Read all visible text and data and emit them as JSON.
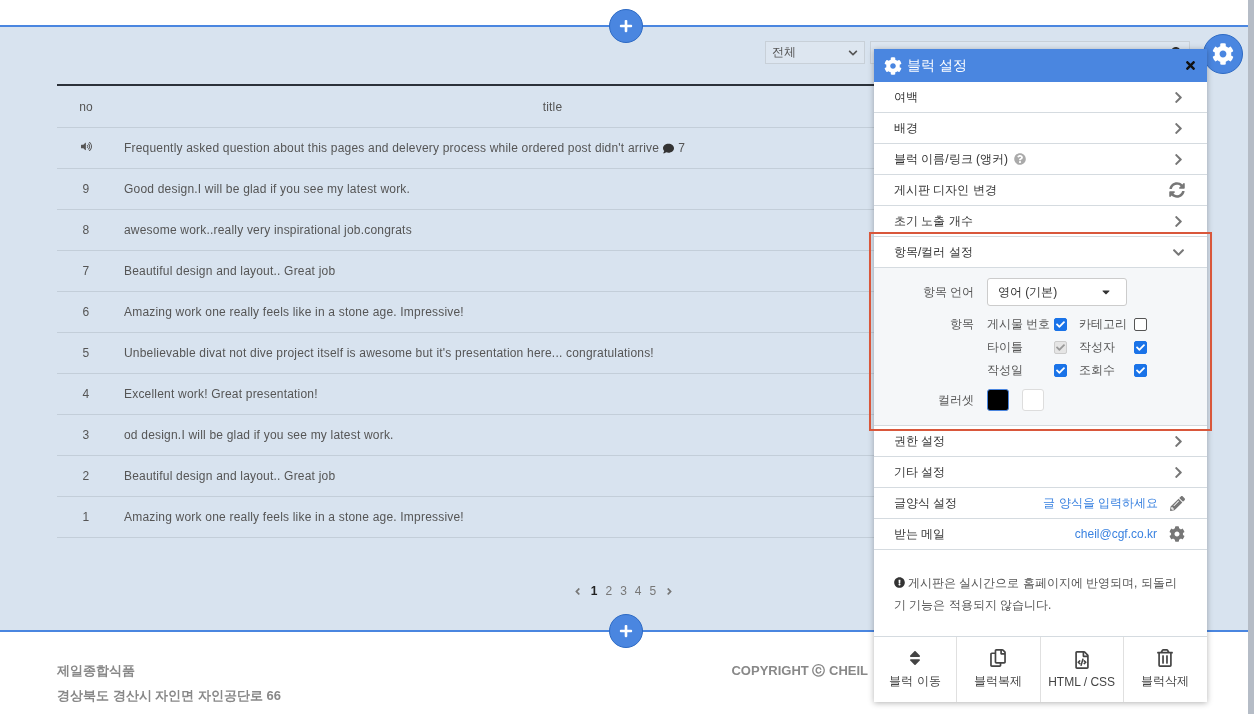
{
  "filter": {
    "value": "전체"
  },
  "table": {
    "columns": [
      "no",
      "title"
    ],
    "rows": [
      {
        "kind": "notice",
        "no": "",
        "title": "Frequently asked question about this pages and delevery process while ordered post didn't arrive",
        "comments": "7"
      },
      {
        "kind": "post",
        "no": "9",
        "title": "Good design.I will be glad if you see my latest work."
      },
      {
        "kind": "post",
        "no": "8",
        "title": "awesome work..really very inspirational job.congrats"
      },
      {
        "kind": "post",
        "no": "7",
        "title": "Beautiful design and layout.. Great job"
      },
      {
        "kind": "post",
        "no": "6",
        "title": "Amazing work one really feels like in a stone age. Impressive!"
      },
      {
        "kind": "post",
        "no": "5",
        "title": "Unbelievable divat not dive project itself is awesome but it's presentation here... congratulations!"
      },
      {
        "kind": "post",
        "no": "4",
        "title": "Excellent work! Great presentation!"
      },
      {
        "kind": "post",
        "no": "3",
        "title": "od design.I will be glad if you see my latest work."
      },
      {
        "kind": "post",
        "no": "2",
        "title": "Beautiful design and layout.. Great job"
      },
      {
        "kind": "post",
        "no": "1",
        "title": "Amazing work one really feels like in a stone age. Impressive!"
      }
    ]
  },
  "pagination": {
    "pages": [
      {
        "label": "1",
        "selected": true
      },
      {
        "label": "2",
        "selected": false
      },
      {
        "label": "3",
        "selected": false
      },
      {
        "label": "4",
        "selected": false
      },
      {
        "label": "5",
        "selected": false
      }
    ]
  },
  "footer": {
    "company": "제일종합식품",
    "address": "경상북도 경산시 자인면 자인공단로 66",
    "copyright": "COPYRIGHT ⓒ CHEIL"
  },
  "panel": {
    "title": "블럭 설정",
    "items": [
      {
        "kind": "section",
        "label": "여백",
        "expanded": false
      },
      {
        "kind": "section",
        "label": "배경",
        "expanded": false
      },
      {
        "kind": "section-help",
        "label": "블럭 이름/링크 (앵커)",
        "expanded": false
      },
      {
        "kind": "refresh",
        "label": "게시판 디자인 변경"
      },
      {
        "kind": "section",
        "label": "초기 노출 개수",
        "expanded": false
      },
      {
        "kind": "section",
        "label": "항목/컬러 설정",
        "expanded": true
      },
      {
        "kind": "section",
        "label": "권한 설정",
        "expanded": false
      },
      {
        "kind": "section",
        "label": "기타 설정",
        "expanded": false
      },
      {
        "kind": "pencil-link",
        "label": "글양식 설정",
        "value": "글 양식을 입력하세요"
      },
      {
        "kind": "gear-link",
        "label": "받는 메일",
        "value": "cheil@cgf.co.kr"
      }
    ],
    "options": {
      "language_label": "항목 언어",
      "language": "영어 (기본)",
      "fields_label": "항목",
      "fields": [
        {
          "label": "게시물 번호",
          "checked": true,
          "disabled": false
        },
        {
          "label": "카테고리",
          "checked": false,
          "disabled": false
        },
        {
          "label": "타이틀",
          "checked": true,
          "disabled": true
        },
        {
          "label": "작성자",
          "checked": true,
          "disabled": false
        },
        {
          "label": "작성일",
          "checked": true,
          "disabled": false
        },
        {
          "label": "조회수",
          "checked": true,
          "disabled": false
        }
      ],
      "colorset_label": "컬러셋",
      "colors": [
        {
          "color": "#000000",
          "selected": true
        },
        {
          "color": "#ffffff",
          "selected": false
        }
      ]
    },
    "notice": "게시판은 실시간으로 홈페이지에 반영되며, 되돌리기 기능은 적용되지 않습니다.",
    "actions": [
      {
        "kind": "move",
        "label": "블럭 이동"
      },
      {
        "kind": "copy",
        "label": "블럭복제"
      },
      {
        "kind": "code",
        "label": "HTML / CSS"
      },
      {
        "kind": "delete",
        "label": "블럭삭제"
      }
    ]
  }
}
